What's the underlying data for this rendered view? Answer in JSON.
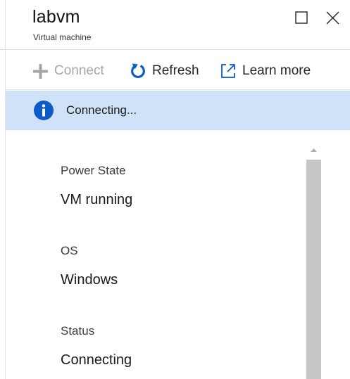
{
  "header": {
    "title": "labvm",
    "subtitle": "Virtual machine",
    "maximize_icon": "maximize-icon",
    "close_icon": "close-icon"
  },
  "toolbar": {
    "connect": {
      "label": "Connect",
      "icon": "plus-icon",
      "enabled": false
    },
    "refresh": {
      "label": "Refresh",
      "icon": "refresh-icon",
      "enabled": true
    },
    "learn_more": {
      "label": "Learn more",
      "icon": "external-link-icon",
      "enabled": true
    }
  },
  "banner": {
    "icon": "info-icon",
    "text": "Connecting..."
  },
  "details": [
    {
      "label": "Power State",
      "value": "VM running"
    },
    {
      "label": "OS",
      "value": "Windows"
    },
    {
      "label": "Status",
      "value": "Connecting"
    }
  ],
  "colors": {
    "accent": "#0b5cc7",
    "banner_background": "#cfe2f7",
    "disabled_text": "#a6a6a6",
    "scrollbar_thumb": "#c6c6c6"
  }
}
